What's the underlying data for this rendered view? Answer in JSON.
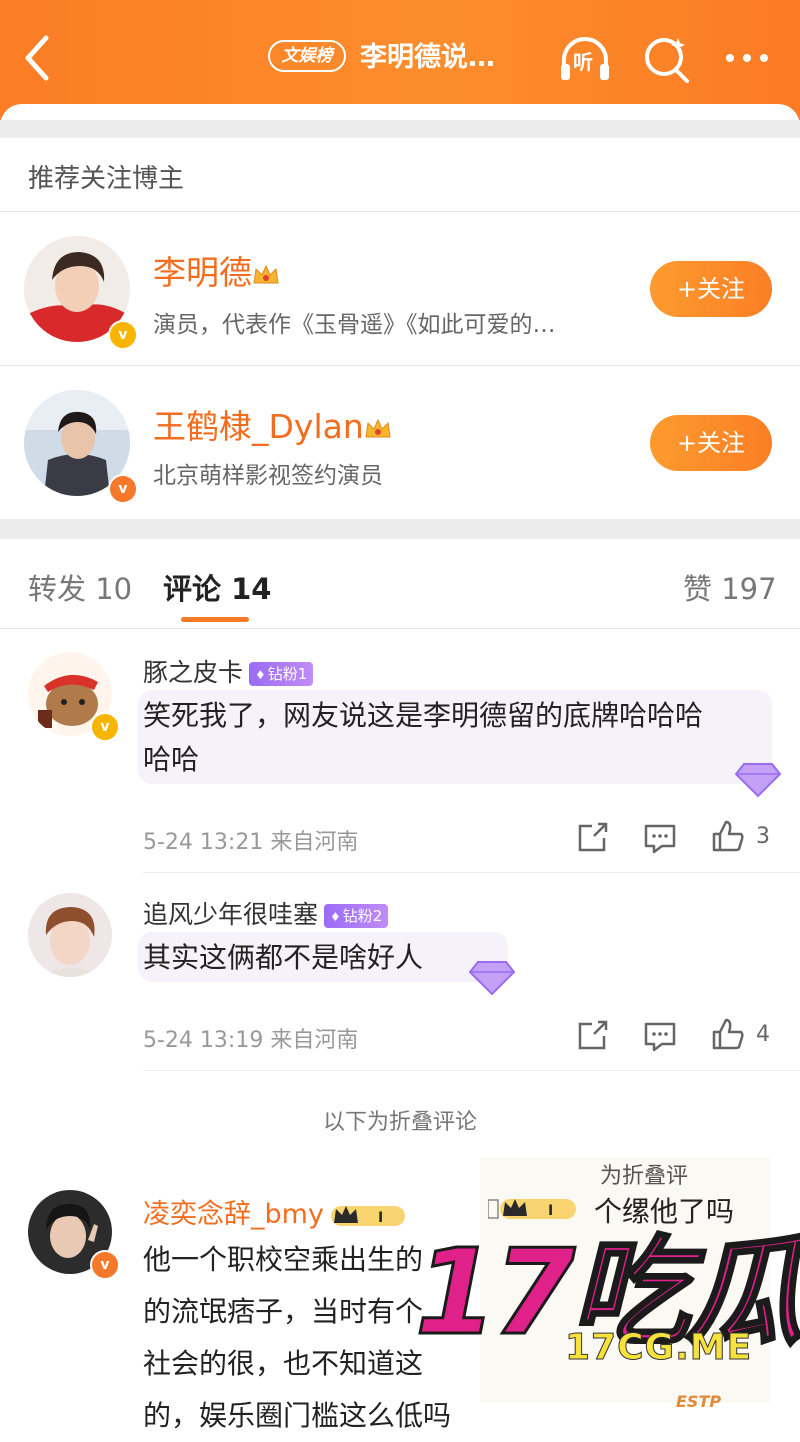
{
  "header": {
    "tag": "文娱榜",
    "title": "李明德说…",
    "listen_label": "听"
  },
  "recommend": {
    "section_title": "推荐关注博主",
    "bloggers": [
      {
        "name": "李明德",
        "desc": "演员，代表作《玉骨遥》《如此可爱的…",
        "follow_label": "+关注"
      },
      {
        "name": "王鹤棣_Dylan",
        "desc": "北京萌样影视签约演员",
        "follow_label": "+关注"
      }
    ]
  },
  "tabs": {
    "repost": "转发 10",
    "comments": "评论 14",
    "likes": "赞 197"
  },
  "comments": [
    {
      "name": "豚之皮卡",
      "badge": "钻粉1",
      "text_line1": "笑死我了，网友说这是李明德留的底牌哈哈哈",
      "text_line2": "哈哈",
      "meta": "5-24 13:21 来自河南",
      "likes": "3"
    },
    {
      "name": "追风少年很哇塞",
      "badge": "钻粉2",
      "text_line1": "其实这俩都不是啥好人",
      "meta": "5-24 13:19 来自河南",
      "likes": "4"
    }
  ],
  "folded_label": "以下为折叠评论",
  "folded_comment": {
    "name": "凌奕念辞_bmy",
    "lines": [
      "他一个职校空乘出生的",
      "的流氓痞子，当时有个",
      "社会的很，也不知道这",
      "的，娱乐圈门槛这么低吗"
    ]
  },
  "overlay": {
    "top_text": "为折叠评",
    "line_text": "个缧他了吗"
  },
  "watermark": {
    "logo": "17吃瓜",
    "url": "17CG.ME",
    "sticker": "ESTP"
  },
  "colors": {
    "brand_orange": "#fb7d25",
    "name_orange": "#f36d1f",
    "fan_purple": "#9b6bf5"
  }
}
